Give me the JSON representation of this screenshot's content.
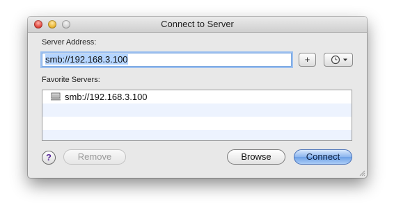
{
  "window": {
    "title": "Connect to Server"
  },
  "server_address": {
    "label": "Server Address:",
    "value": "smb://192.168.3.100"
  },
  "add_button": {
    "label": "+"
  },
  "recent_button": {
    "icon": "clock-icon"
  },
  "favorites": {
    "label": "Favorite Servers:",
    "items": [
      {
        "label": "smb://192.168.3.100",
        "icon": "server-icon"
      }
    ]
  },
  "buttons": {
    "help": "?",
    "remove": "Remove",
    "browse": "Browse",
    "connect": "Connect"
  },
  "colors": {
    "focus_ring": "#9cc0f0",
    "selection": "#b5d5ff",
    "alt_row": "#edf3fe",
    "default_button": "#6ea1e6"
  }
}
